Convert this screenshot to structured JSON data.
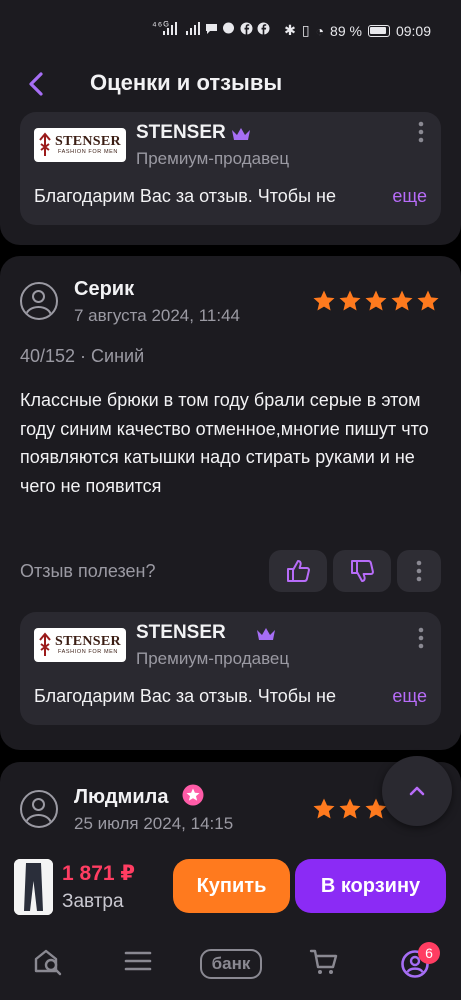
{
  "status_bar": {
    "network": "⁴⁶ᴳ",
    "battery": "89 %",
    "time": "09:09"
  },
  "header": {
    "title": "Оценки и отзывы"
  },
  "seller_reply": {
    "seller_name": "STENSER",
    "seller_role": "Премиум-продавец",
    "logo_brand": "STENSER",
    "logo_sub": "FASHION FOR MEN",
    "text": "Благодарим Вас за отзыв. Чтобы не",
    "more_label": "еще"
  },
  "review": {
    "author": "Серик",
    "date": "7 августа 2024, 11:44",
    "rating": 5,
    "variant": "40/152 · Синий",
    "text": "Классные брюки в том году брали серые в этом году синим качество отменное,многие пишут что появляются катышки надо стирать руками и не чего не появится",
    "helpful_label": "Отзыв полезен?"
  },
  "next_review": {
    "author": "Людмила",
    "date": "25 июля 2024, 14:15"
  },
  "product_bar": {
    "price": "1 871 ₽",
    "delivery": "Завтра",
    "buy_label": "Купить",
    "cart_label": "В корзину"
  },
  "tab_bar": {
    "bank_label": "банк",
    "profile_badge": "6"
  },
  "colors": {
    "accent": "#8b2bf5",
    "link": "#b76cf8",
    "star": "#ff7a1e",
    "price": "#ff3d62",
    "buy": "#ff7a1e"
  }
}
